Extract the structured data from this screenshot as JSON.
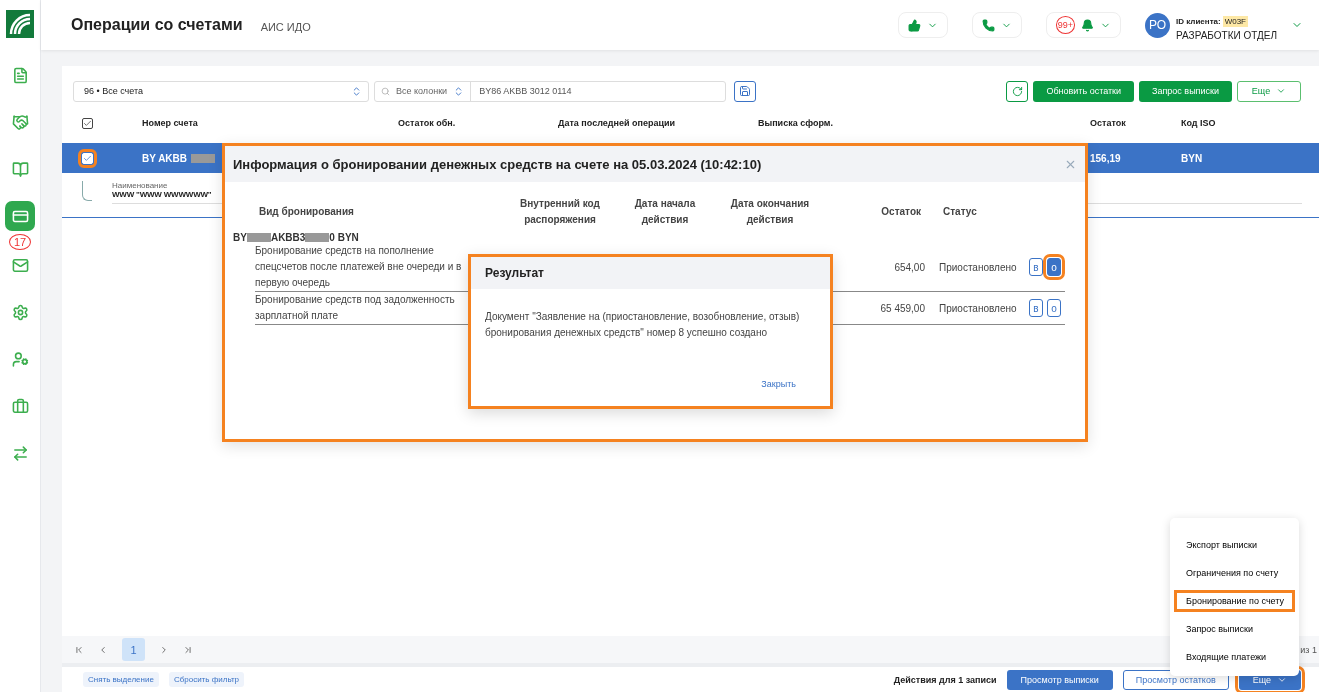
{
  "header": {
    "title": "Операции со счетами",
    "subtitle": "АИС ИДО",
    "notifications_badge": "99+",
    "avatar": "РО",
    "client_id_label": "ID клиента:",
    "client_id": "W03F",
    "org_name": "РАЗРАБОТКИ ОТДЕЛ"
  },
  "sidebar": {
    "items": [
      {
        "selected": false
      },
      {
        "selected": false
      },
      {
        "selected": false
      },
      {
        "selected": true
      },
      {
        "selected": false,
        "badge": "17"
      },
      {
        "selected": false
      },
      {
        "selected": false
      },
      {
        "selected": false
      },
      {
        "selected": false
      }
    ]
  },
  "toolbar": {
    "account_filter": "96 • Все счета",
    "search_scope": "Все колонки",
    "search_value": "BY86 AKBB 3012 0114",
    "buttons": [
      "Обновить остатки",
      "Запрос выписки"
    ],
    "more": "Еще"
  },
  "table": {
    "select_all_checked": true,
    "columns": [
      "Номер счета",
      "Остаток обн.",
      "Дата последней операции",
      "Выписка сформ.",
      "Остаток",
      "Код ISO"
    ],
    "rows": [
      {
        "selected": true,
        "highlighted": true,
        "account_parts": [
          "BY",
          "AKBB"
        ],
        "balance": "156,19",
        "iso": "BYN",
        "name_label": "Наименование",
        "name": "WWW \"WWW WWWWWW\""
      }
    ]
  },
  "modal": {
    "highlighted": true,
    "title": "Информация о бронировании денежных средств на счете на 05.03.2024 (10:42:10)",
    "columns": [
      "Вид бронирования",
      "Внутренний код распоряжения",
      "Дата начала действия",
      "Дата окончания действия",
      "Остаток",
      "Статус"
    ],
    "account_parts": [
      "BY",
      "AKBB3",
      "0 BYN"
    ],
    "rows": [
      {
        "type": "Бронирование средств на пополнение спецсчетов после платежей вне очереди и в первую очередь",
        "balance": "654,00",
        "status": "Приостановлено",
        "actions": [
          {
            "label": "в",
            "active": false,
            "highlighted": false
          },
          {
            "label": "о",
            "active": true,
            "highlighted": true
          }
        ]
      },
      {
        "type": "Бронирование средств под задолженность зарплатной плате",
        "balance": "65 459,00",
        "status": "Приостановлено",
        "actions": [
          {
            "label": "в",
            "active": false,
            "highlighted": false
          },
          {
            "label": "о",
            "active": false,
            "highlighted": false
          }
        ]
      }
    ]
  },
  "result_dialog": {
    "highlighted": true,
    "title": "Результат",
    "message": "Документ \"Заявление на (приостановление, возобновление, отзыв) бронирования денежных средств\" номер 8 успешно создано",
    "close": "Закрыть"
  },
  "pagination": {
    "page": "1",
    "total": "из 1"
  },
  "menu": {
    "items": [
      {
        "label": "Экспорт выписки",
        "highlighted": false
      },
      {
        "label": "Ограничения по счету",
        "highlighted": false
      },
      {
        "label": "Бронирование по счету",
        "highlighted": true
      },
      {
        "label": "Запрос выписки",
        "highlighted": false
      },
      {
        "label": "Входящие платежи",
        "highlighted": false
      }
    ]
  },
  "footer": {
    "left": [
      "Снять выделение",
      "Сбросить фильтр"
    ],
    "actions_label": "Действия для 1 записи",
    "buttons": [
      "Просмотр выписки",
      "Просмотр остатков"
    ],
    "more": {
      "label": "Еще",
      "highlighted": true
    }
  }
}
